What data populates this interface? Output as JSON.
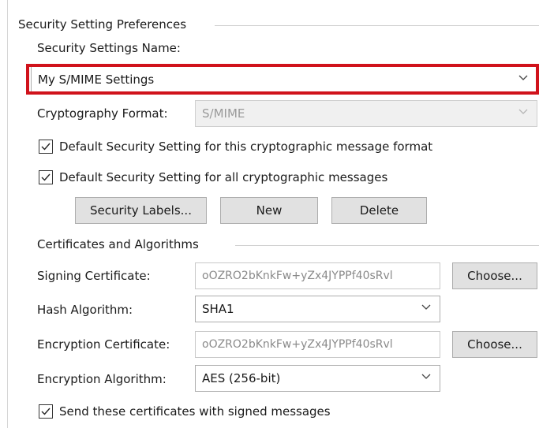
{
  "group": {
    "title": "Security Setting Preferences",
    "settings_name_label": "Security Settings Name:",
    "settings_name_value": "My S/MIME Settings",
    "crypto_format_label": "Cryptography Format:",
    "crypto_format_value": "S/MIME",
    "check_default_format_label": "Default Security Setting for this cryptographic message format",
    "check_default_format_checked": true,
    "check_default_all_label": "Default Security Setting for all cryptographic messages",
    "check_default_all_checked": true,
    "buttons": {
      "security_labels": "Security Labels...",
      "new": "New",
      "delete": "Delete"
    }
  },
  "certs": {
    "title": "Certificates and Algorithms",
    "signing_label": "Signing Certificate:",
    "signing_value": "oOZRO2bKnkFw+yZx4JYPPf40sRvl",
    "hash_label": "Hash Algorithm:",
    "hash_value": "SHA1",
    "encryption_cert_label": "Encryption Certificate:",
    "encryption_cert_value": "oOZRO2bKnkFw+yZx4JYPPf40sRvl",
    "encryption_alg_label": "Encryption Algorithm:",
    "encryption_alg_value": "AES (256-bit)",
    "choose_label": "Choose...",
    "send_certs_label": "Send these certificates with signed messages",
    "send_certs_checked": true
  },
  "colors": {
    "highlight": "#d0121b",
    "disabled_text": "#9a9a9a"
  },
  "icons": [
    "chevron-down-icon",
    "checkmark-icon"
  ]
}
